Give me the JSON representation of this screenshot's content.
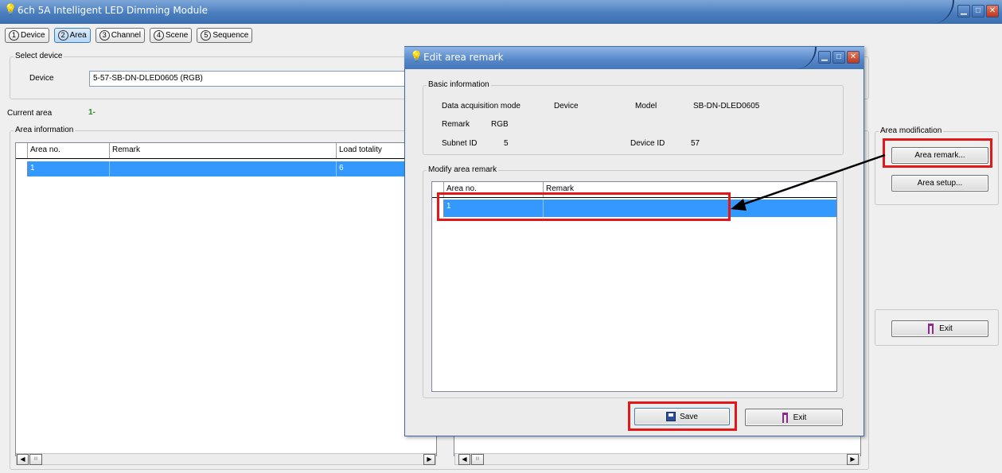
{
  "window": {
    "title": "6ch 5A Intelligent LED Dimming Module",
    "icon": "bulb-icon"
  },
  "tabs": [
    {
      "num": "1",
      "label": "Device"
    },
    {
      "num": "2",
      "label": "Area"
    },
    {
      "num": "3",
      "label": "Channel"
    },
    {
      "num": "4",
      "label": "Scene"
    },
    {
      "num": "5",
      "label": "Sequence"
    }
  ],
  "select_device": {
    "legend": "Select device",
    "label": "Device",
    "value": "5-57-SB-DN-DLED0605 (RGB)"
  },
  "current_area": {
    "label": "Current area",
    "value": "1-"
  },
  "area_info": {
    "legend": "Area information",
    "columns": [
      "Area no.",
      "Remark",
      "Load totality"
    ],
    "rows": [
      {
        "area": "1",
        "remark": "",
        "load": "6"
      }
    ]
  },
  "area_modification": {
    "legend": "Area modification",
    "remark_button": "Area remark...",
    "setup_button": "Area setup..."
  },
  "exit_button": "Exit",
  "dialog": {
    "title": "Edit area remark",
    "basic": {
      "legend": "Basic information",
      "mode_label": "Data acquisition mode",
      "mode_value": "Device",
      "model_label": "Model",
      "model_value": "SB-DN-DLED0605",
      "remark_label": "Remark",
      "remark_value": "RGB",
      "subnet_label": "Subnet ID",
      "subnet_value": "5",
      "device_label": "Device ID",
      "device_value": "57"
    },
    "modify": {
      "legend": "Modify area remark",
      "columns": [
        "Area no.",
        "Remark"
      ],
      "rows": [
        {
          "area": "1",
          "remark": ""
        }
      ]
    },
    "save_button": "Save",
    "exit_button": "Exit"
  },
  "scroll": {
    "left_glyph": "◀",
    "right_glyph": "▶",
    "thumb_glyph": "III"
  },
  "colors": {
    "selection": "#3399ff",
    "highlight_box": "#e21818",
    "title_blue": "#4a7ebf"
  }
}
